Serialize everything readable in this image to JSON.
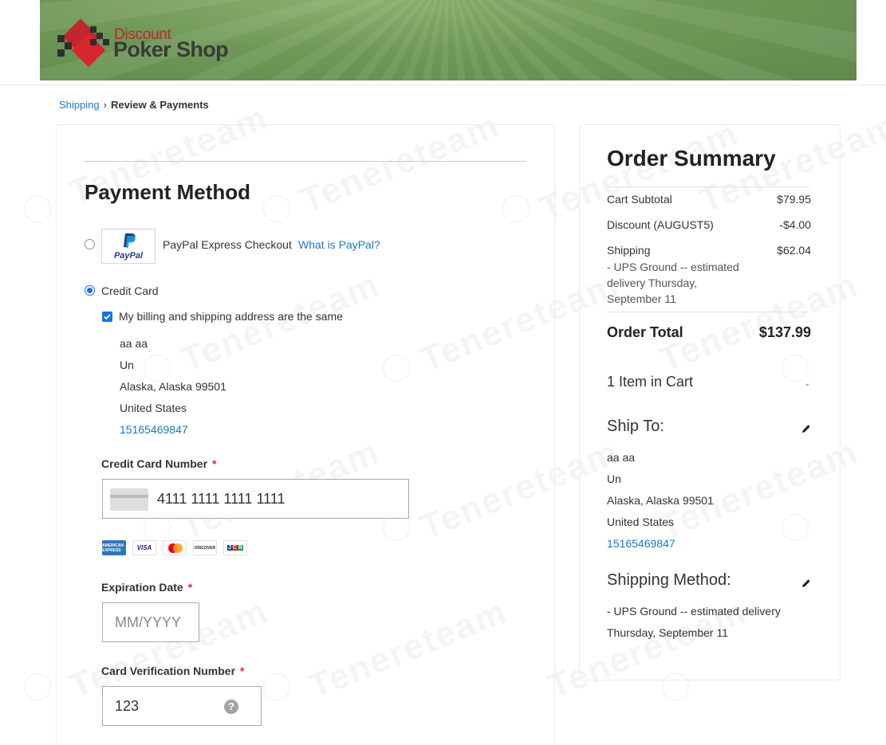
{
  "brand": {
    "line1": "Discount",
    "line2": "Poker Shop",
    "colors": {
      "banner": "#6f9858",
      "logo_red": "#c1272d",
      "logo_dark": "#3a3a3a"
    }
  },
  "breadcrumb": {
    "shipping": "Shipping",
    "separator": "›",
    "current": "Review & Payments"
  },
  "payment": {
    "title": "Payment Method",
    "paypal": {
      "logo_word": "PayPal",
      "label": "PayPal Express Checkout",
      "help_link": "What is PayPal?",
      "selected": false
    },
    "credit_card": {
      "label": "Credit Card",
      "selected": true,
      "same_address_label": "My billing and shipping address are the same",
      "same_address_checked": true
    },
    "billing_address": {
      "name": "aa aa",
      "street": "Un",
      "city_region_zip": "Alaska, Alaska 99501",
      "country": "United States",
      "phone": "15165469847"
    },
    "fields": {
      "card_number_label": "Credit Card Number",
      "card_number_value": "4111 1111 1111 1111",
      "expiration_label": "Expiration Date",
      "expiration_placeholder": "MM/YYYY",
      "cvv_label": "Card Verification Number",
      "cvv_value": "123",
      "required_mark": "*"
    },
    "card_types": [
      "AMERICAN EXPRESS",
      "VISA",
      "MasterCard",
      "DISCOVER",
      "JCB"
    ]
  },
  "summary": {
    "title": "Order Summary",
    "subtotal_label": "Cart Subtotal",
    "subtotal_value": "$79.95",
    "discount_label": "Discount (AUGUST5)",
    "discount_value": "-$4.00",
    "shipping_label": "Shipping",
    "shipping_value": "$62.04",
    "shipping_desc_1": "- UPS Ground -- estimated",
    "shipping_desc_2": "delivery Thursday,",
    "shipping_desc_3": "September 11",
    "total_label": "Order Total",
    "total_value": "$137.99",
    "items_in_cart": "1 Item in Cart",
    "ship_to_title": "Ship To:",
    "ship_to": {
      "name": "aa aa",
      "street": "Un",
      "city_region_zip": "Alaska, Alaska 99501",
      "country": "United States",
      "phone": "15165469847"
    },
    "shipping_method_title": "Shipping Method:",
    "shipping_method_1": "- UPS Ground -- estimated delivery",
    "shipping_method_2": "Thursday, September 11"
  },
  "watermark": "Tenereteam"
}
